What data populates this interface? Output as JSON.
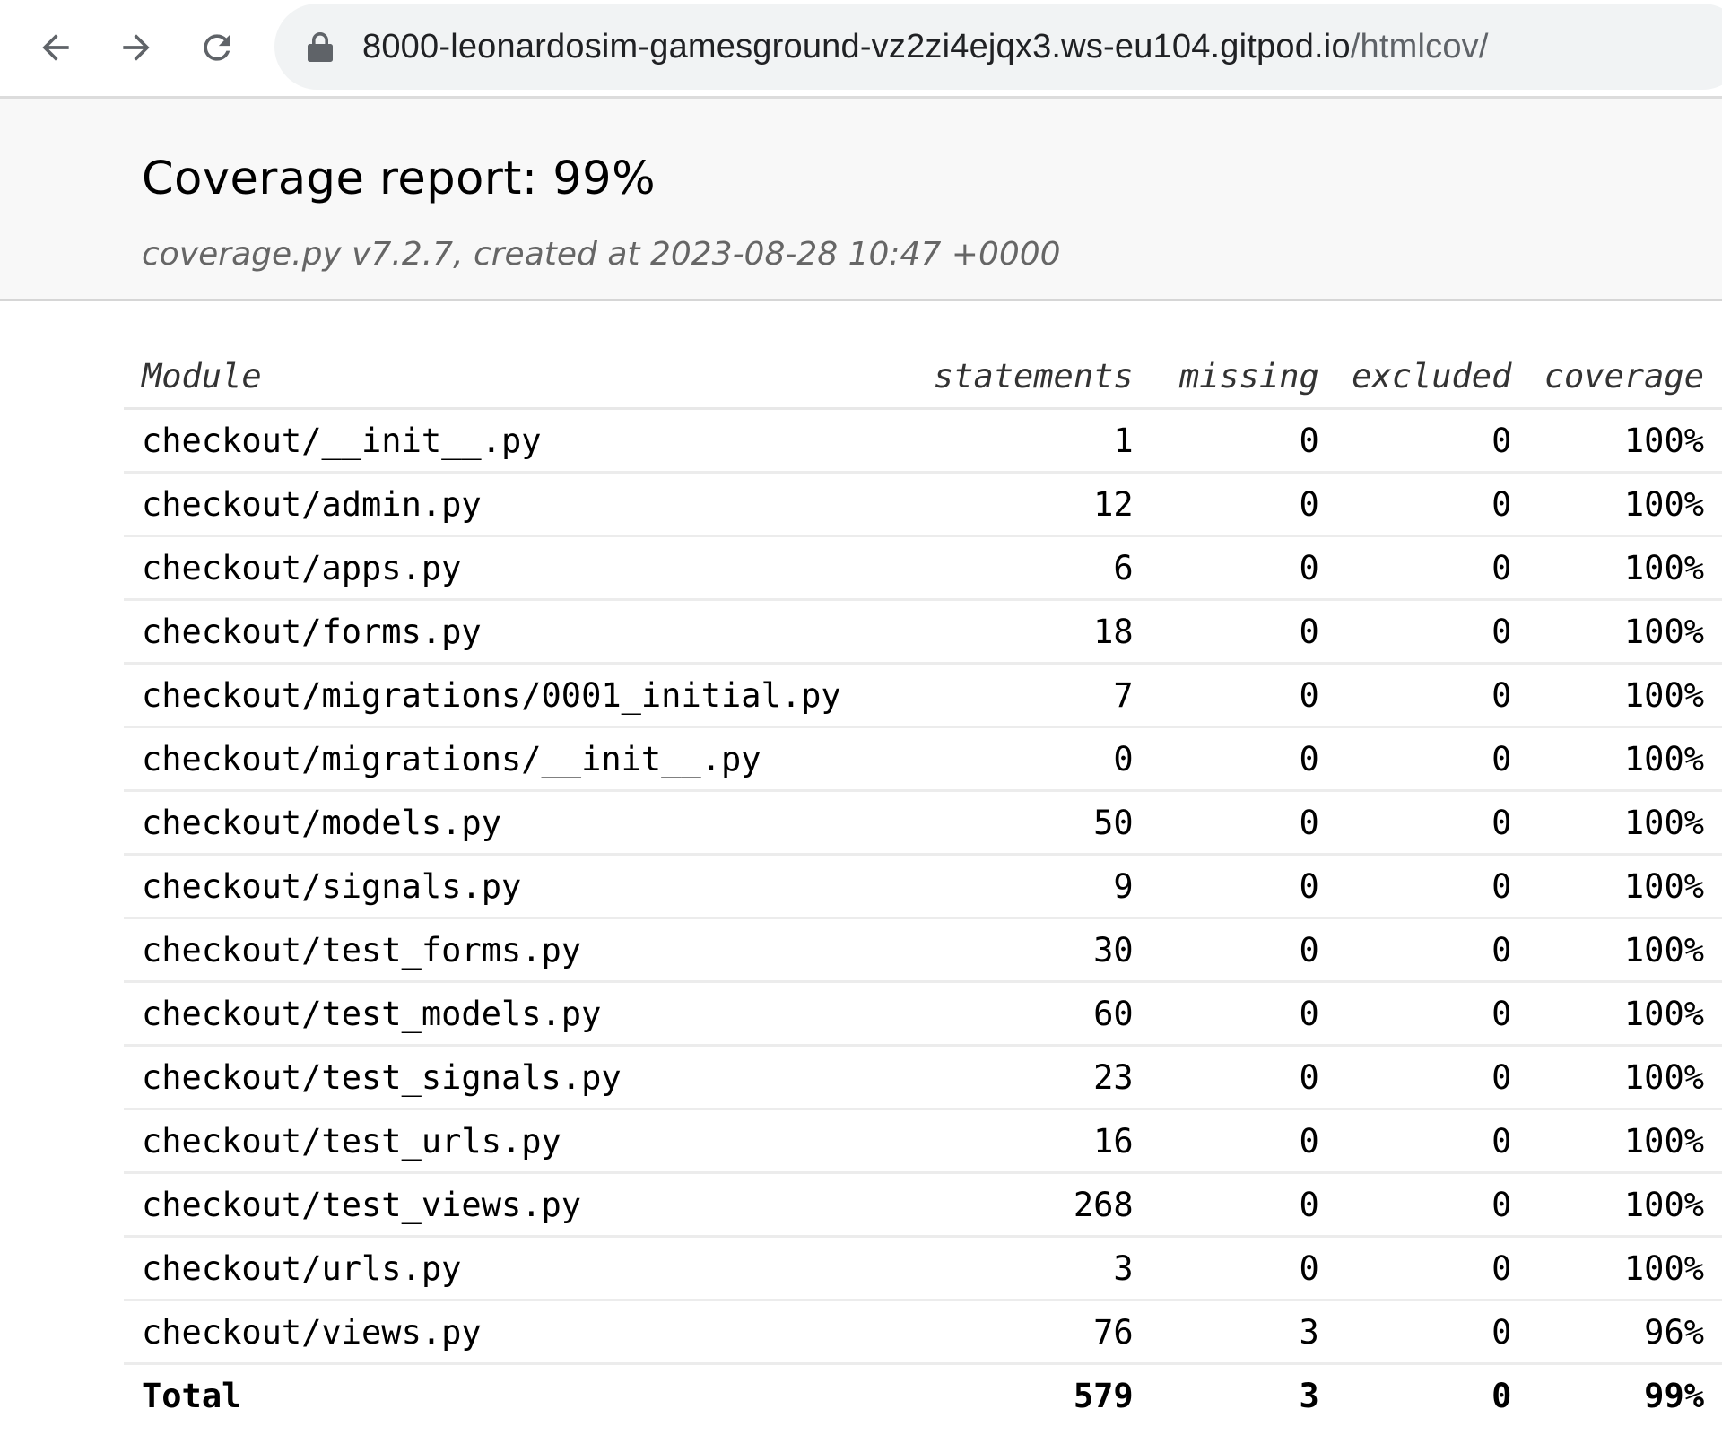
{
  "browser": {
    "url_host": "8000-leonardosim-gamesground-vz2zi4ejqx3.ws-eu104.gitpod.io",
    "url_path": "/htmlcov/",
    "icons": [
      "back-arrow-icon",
      "forward-arrow-icon",
      "reload-icon",
      "lock-icon"
    ]
  },
  "header": {
    "title": "Coverage report: 99%",
    "subtitle": "coverage.py v7.2.7, created at 2023-08-28 10:47 +0000"
  },
  "table": {
    "columns": [
      "Module",
      "statements",
      "missing",
      "excluded",
      "coverage"
    ],
    "rows": [
      {
        "module": "checkout/__init__.py",
        "statements": "1",
        "missing": "0",
        "excluded": "0",
        "coverage": "100%"
      },
      {
        "module": "checkout/admin.py",
        "statements": "12",
        "missing": "0",
        "excluded": "0",
        "coverage": "100%"
      },
      {
        "module": "checkout/apps.py",
        "statements": "6",
        "missing": "0",
        "excluded": "0",
        "coverage": "100%"
      },
      {
        "module": "checkout/forms.py",
        "statements": "18",
        "missing": "0",
        "excluded": "0",
        "coverage": "100%"
      },
      {
        "module": "checkout/migrations/0001_initial.py",
        "statements": "7",
        "missing": "0",
        "excluded": "0",
        "coverage": "100%"
      },
      {
        "module": "checkout/migrations/__init__.py",
        "statements": "0",
        "missing": "0",
        "excluded": "0",
        "coverage": "100%"
      },
      {
        "module": "checkout/models.py",
        "statements": "50",
        "missing": "0",
        "excluded": "0",
        "coverage": "100%"
      },
      {
        "module": "checkout/signals.py",
        "statements": "9",
        "missing": "0",
        "excluded": "0",
        "coverage": "100%"
      },
      {
        "module": "checkout/test_forms.py",
        "statements": "30",
        "missing": "0",
        "excluded": "0",
        "coverage": "100%"
      },
      {
        "module": "checkout/test_models.py",
        "statements": "60",
        "missing": "0",
        "excluded": "0",
        "coverage": "100%"
      },
      {
        "module": "checkout/test_signals.py",
        "statements": "23",
        "missing": "0",
        "excluded": "0",
        "coverage": "100%"
      },
      {
        "module": "checkout/test_urls.py",
        "statements": "16",
        "missing": "0",
        "excluded": "0",
        "coverage": "100%"
      },
      {
        "module": "checkout/test_views.py",
        "statements": "268",
        "missing": "0",
        "excluded": "0",
        "coverage": "100%"
      },
      {
        "module": "checkout/urls.py",
        "statements": "3",
        "missing": "0",
        "excluded": "0",
        "coverage": "100%"
      },
      {
        "module": "checkout/views.py",
        "statements": "76",
        "missing": "3",
        "excluded": "0",
        "coverage": "96%"
      }
    ],
    "total": {
      "module": "Total",
      "statements": "579",
      "missing": "3",
      "excluded": "0",
      "coverage": "99%"
    }
  }
}
